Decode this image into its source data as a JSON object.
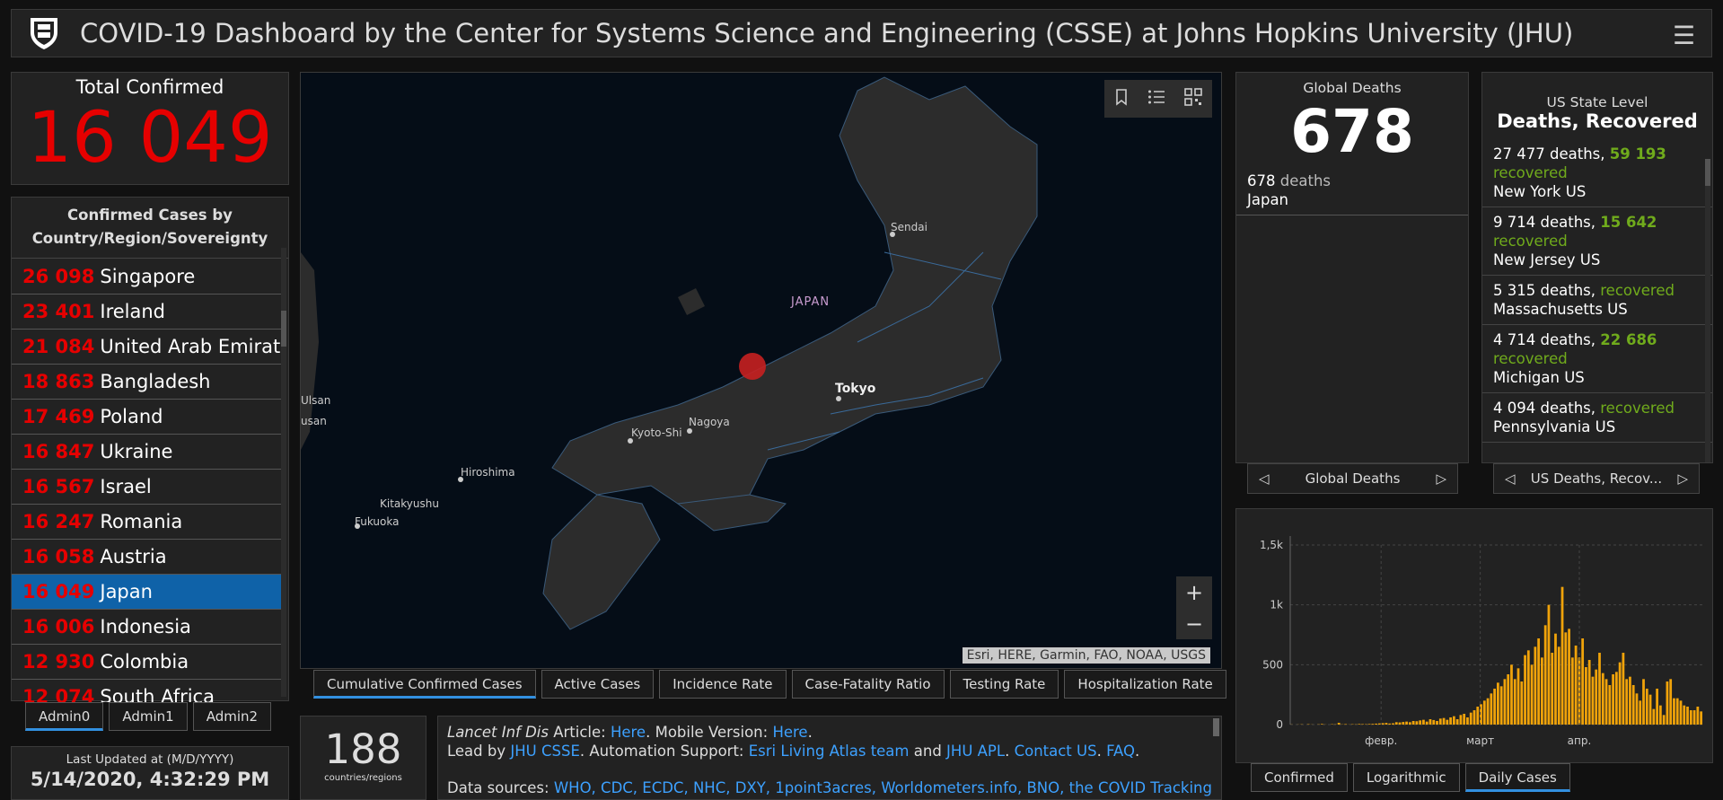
{
  "header": {
    "title": "COVID-19 Dashboard by the Center for Systems Science and Engineering (CSSE) at Johns Hopkins University (JHU)"
  },
  "total": {
    "label": "Total Confirmed",
    "value": "16 049"
  },
  "list": {
    "title_l1": "Confirmed Cases by",
    "title_l2": "Country/Region/Sovereignty",
    "rows": [
      {
        "n": "26 098",
        "c": "Singapore"
      },
      {
        "n": "23 401",
        "c": "Ireland"
      },
      {
        "n": "21 084",
        "c": "United Arab Emirates"
      },
      {
        "n": "18 863",
        "c": "Bangladesh"
      },
      {
        "n": "17 469",
        "c": "Poland"
      },
      {
        "n": "16 847",
        "c": "Ukraine"
      },
      {
        "n": "16 567",
        "c": "Israel"
      },
      {
        "n": "16 247",
        "c": "Romania"
      },
      {
        "n": "16 058",
        "c": "Austria"
      },
      {
        "n": "16 049",
        "c": "Japan"
      },
      {
        "n": "16 006",
        "c": "Indonesia"
      },
      {
        "n": "12 930",
        "c": "Colombia"
      },
      {
        "n": "12 074",
        "c": "South Africa"
      }
    ],
    "selected_index": 9
  },
  "admin_tabs": [
    "Admin0",
    "Admin1",
    "Admin2"
  ],
  "updated": {
    "label": "Last Updated at (M/D/YYYY)",
    "value": "5/14/2020, 4:32:29 PM"
  },
  "map": {
    "country": "JAPAN",
    "cities": [
      "Sendai",
      "Tokyo",
      "Nagoya",
      "Kyoto-Shi",
      "Hiroshima",
      "Kitakyushu",
      "Fukuoka",
      "Ulsan",
      "usan"
    ],
    "attribution": "Esri, HERE, Garmin, FAO, NOAA, USGS",
    "zoom_in": "+",
    "zoom_out": "−"
  },
  "map_tabs": [
    "Cumulative Confirmed Cases",
    "Active Cases",
    "Incidence Rate",
    "Case-Fatality Ratio",
    "Testing Rate",
    "Hospitalization Rate"
  ],
  "countries": {
    "value": "188",
    "label": "countries/regions"
  },
  "info": {
    "l1a": "Lancet Inf Dis",
    "l1b": " Article: ",
    "l1c": "Here",
    "l1d": ". Mobile Version: ",
    "l1e": "Here",
    "l1f": ".",
    "l2a": "Lead by ",
    "l2b": "JHU CSSE",
    "l2c": ". Automation Support: ",
    "l2d": "Esri Living Atlas team",
    "l2e": " and ",
    "l2f": "JHU APL",
    "l2g": ". ",
    "l2h": "Contact US",
    "l2i": ". ",
    "l2j": "FAQ",
    "l2k": ".",
    "l3a": "Data sources: ",
    "l3b": "WHO, CDC, ECDC, NHC, DXY, 1point3acres, Worldometers.info, BNO, the COVID Tracking"
  },
  "global_deaths": {
    "title": "Global Deaths",
    "value": "678",
    "sub_num": "678",
    "sub_label": "deaths",
    "sub_place": "Japan",
    "nav_label": "Global Deaths"
  },
  "us": {
    "title_l1": "US State Level",
    "title_l2": "Deaths, Recovered",
    "nav_label": "US Deaths, Recov...",
    "rows": [
      {
        "d": "27 477",
        "r": "59 193",
        "p": "New York US"
      },
      {
        "d": "9 714",
        "r": "15 642",
        "p": "New Jersey US"
      },
      {
        "d": "5 315",
        "r": "",
        "p": "Massachusetts US"
      },
      {
        "d": "4 714",
        "r": "22 686",
        "p": "Michigan US"
      },
      {
        "d": "4 094",
        "r": "",
        "p": "Pennsylvania US"
      }
    ],
    "deaths_word": "deaths,",
    "recovered_word": "recovered"
  },
  "chart_tabs": [
    "Confirmed",
    "Logarithmic",
    "Daily Cases"
  ],
  "chart_data": {
    "type": "bar",
    "yticks": [
      "0",
      "500",
      "1k",
      "1,5k"
    ],
    "ylim": [
      0,
      1500
    ],
    "xticks": [
      "февр.",
      "март",
      "апр."
    ],
    "color": "#f0a30a",
    "values": [
      1,
      0,
      1,
      2,
      0,
      3,
      1,
      0,
      2,
      5,
      1,
      0,
      3,
      2,
      15,
      2,
      4,
      1,
      3,
      2,
      5,
      4,
      3,
      5,
      6,
      8,
      10,
      12,
      14,
      9,
      11,
      20,
      18,
      22,
      25,
      20,
      30,
      28,
      35,
      40,
      25,
      45,
      38,
      30,
      50,
      55,
      40,
      60,
      70,
      45,
      80,
      90,
      60,
      100,
      120,
      150,
      170,
      200,
      220,
      260,
      300,
      350,
      320,
      380,
      420,
      500,
      380,
      470,
      360,
      580,
      620,
      500,
      650,
      720,
      560,
      830,
      1000,
      600,
      760,
      650,
      1150,
      770,
      800,
      560,
      660,
      560,
      720,
      480,
      540,
      400,
      460,
      600,
      430,
      380,
      330,
      420,
      440,
      520,
      600,
      380,
      400,
      330,
      260,
      200,
      380,
      300,
      250,
      130,
      300,
      160,
      80,
      360,
      380,
      220,
      220,
      200,
      160,
      150,
      120,
      120,
      150,
      110
    ]
  }
}
